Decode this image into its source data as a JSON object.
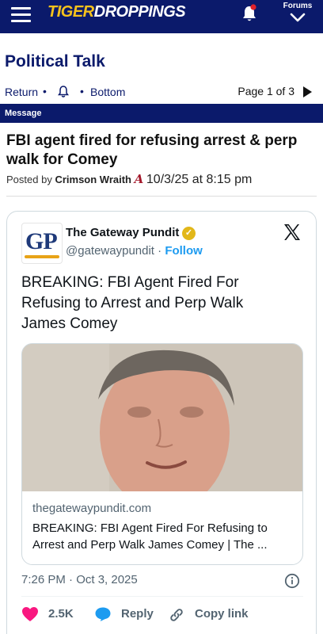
{
  "topbar": {
    "logo_part1": "TIGER",
    "logo_part2": "DROPPINGS",
    "forums_label": "Forums"
  },
  "forum": {
    "title": "Political Talk",
    "return_label": "Return",
    "bottom_label": "Bottom",
    "page_indicator": "Page 1 of 3"
  },
  "message_bar": {
    "label": "Message"
  },
  "post": {
    "title": "FBI agent fired for refusing arrest & perp walk for Comey",
    "posted_by_label": "Posted by",
    "author": "Crimson Wraith",
    "date": "10/3/25 at 8:15 pm"
  },
  "tweet": {
    "account_initials": "GP",
    "account_name": "The Gateway Pundit",
    "handle": "@gatewaypundit",
    "handle_sep": " · ",
    "follow_label": "Follow",
    "text": "BREAKING: FBI Agent Fired For Refusing to Arrest and Perp Walk James Comey",
    "link_domain": "thegatewaypundit.com",
    "link_title": "BREAKING: FBI Agent Fired For Refusing to Arrest and Perp Walk James Comey | The ...",
    "timestamp": "7:26 PM · Oct 3, 2025",
    "likes": "2.5K",
    "reply_label": "Reply",
    "copy_link_label": "Copy link"
  },
  "colors": {
    "brand_navy": "#0b1a6b",
    "brand_gold": "#f6c21c",
    "link_blue": "#1d9bf0",
    "like_pink": "#f91880",
    "notification_red": "#e0222a"
  },
  "icons": [
    "hamburger-icon",
    "bell-icon",
    "chevron-down-icon",
    "notification-bell-icon",
    "next-page-arrow-icon",
    "verified-badge-icon",
    "x-logo-icon",
    "info-icon",
    "heart-icon",
    "reply-icon",
    "link-icon"
  ]
}
